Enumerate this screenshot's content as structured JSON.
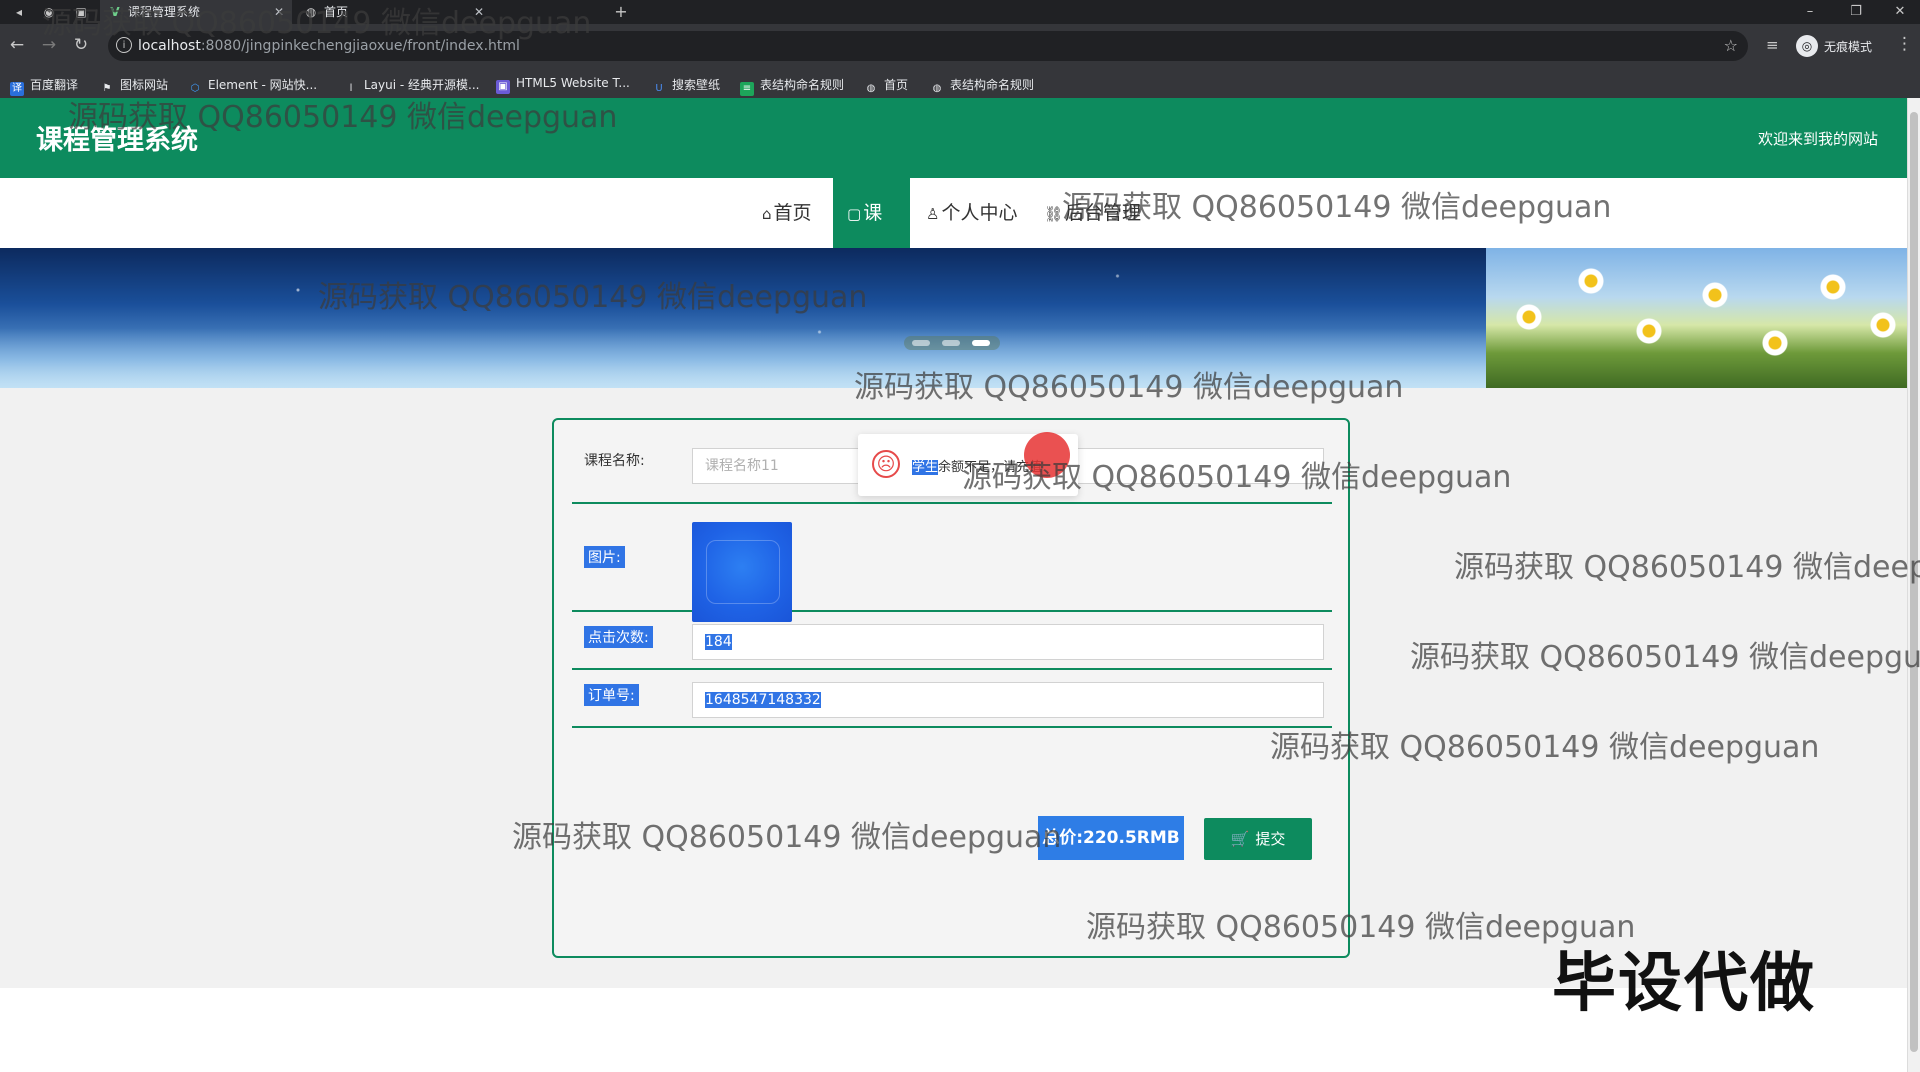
{
  "browser": {
    "tabs": [
      {
        "title": "课程管理系统",
        "active": true
      },
      {
        "title": "首页",
        "active": false
      }
    ],
    "url_host": "localhost",
    "url_path": ":8080/jingpinkechengjiaoxue/front/index.html",
    "incognito_label": "无痕模式",
    "bookmarks": [
      "百度翻译",
      "图标网站",
      "Element - 网站快...",
      "Layui - 经典开源模...",
      "HTML5 Website T...",
      "搜索壁纸",
      "表结构命名规则",
      "首页",
      "表结构命名规则"
    ]
  },
  "site": {
    "title": "课程管理系统",
    "welcome": "欢迎来到我的网站"
  },
  "nav": [
    {
      "label": "首页",
      "icon": "home-icon",
      "active": false
    },
    {
      "label": "课程",
      "icon": "course-icon",
      "active": true
    },
    {
      "label": "个人中心",
      "icon": "user-icon",
      "active": false
    },
    {
      "label": "后台管理",
      "icon": "link-icon",
      "active": false
    }
  ],
  "form": {
    "course_name_label": "课程名称:",
    "course_name_value": "课程名称11",
    "image_label": "图片:",
    "clicks_label": "点击次数:",
    "clicks_value": "184",
    "order_label": "订单号:",
    "order_value": "1648547148332",
    "total_label": "总价:220.5RMB",
    "submit_label": "提交"
  },
  "toast": {
    "highlight": "学生",
    "message": "余额不足，请充值"
  },
  "watermark_text": "源码获取 QQ86050149 微信deepguan",
  "corner_text": "毕设代做",
  "colors": {
    "brand_green": "#0d8b5e",
    "selection_blue": "#3074e5",
    "error_red": "#e64a4a"
  }
}
